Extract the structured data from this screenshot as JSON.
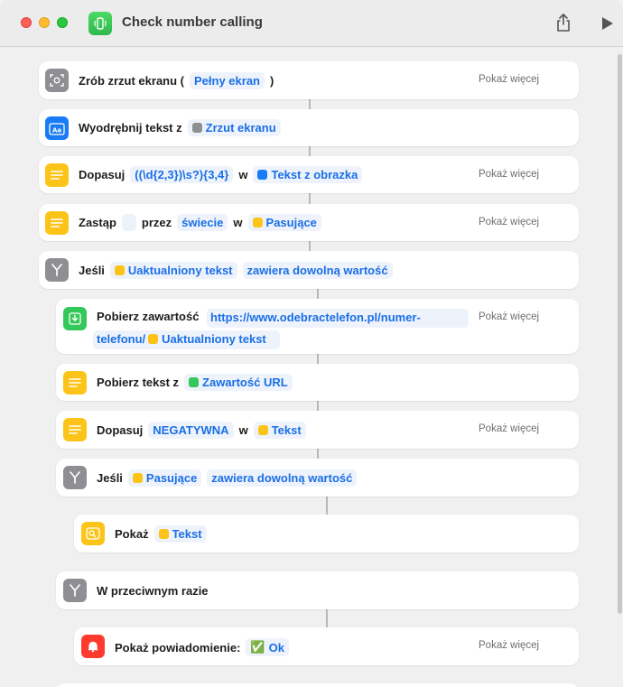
{
  "window": {
    "title": "Check number calling"
  },
  "more_label": "Pokaż więcej",
  "actions": {
    "screenshot": {
      "label": "Zrób zrzut ekranu (",
      "mode": "Pełny ekran",
      "close": ")"
    },
    "extract": {
      "label": "Wyodrębnij tekst z",
      "source": "Zrzut ekranu"
    },
    "match1": {
      "label": "Dopasuj",
      "pattern": "((\\d{2,3})\\s?){3,4}",
      "in": "w",
      "source": "Tekst z obrazka"
    },
    "replace": {
      "label": "Zastąp",
      "with": "przez",
      "replacement": "świecie",
      "in": "w",
      "source": "Pasujące"
    },
    "if1": {
      "label": "Jeśli",
      "var": "Uaktualniony tekst",
      "cond": "zawiera dowolną wartość"
    },
    "geturl": {
      "label": "Pobierz zawartość",
      "url1": "https://www.odebractelefon.pl/numer-",
      "url2": "telefonu/",
      "var": "Uaktualniony tekst"
    },
    "gettext": {
      "label": "Pobierz tekst z",
      "source": "Zawartość URL"
    },
    "match2": {
      "label": "Dopasuj",
      "pattern": "NEGATYWNA",
      "in": "w",
      "source": "Tekst"
    },
    "if2": {
      "label": "Jeśli",
      "var": "Pasujące",
      "cond": "zawiera dowolną wartość"
    },
    "show": {
      "label": "Pokaż",
      "var": "Tekst"
    },
    "otherwise": {
      "label": "W przeciwnym razie"
    },
    "notify": {
      "label": "Pokaż powiadomienie:",
      "emoji": "✅",
      "text": "Ok"
    }
  }
}
